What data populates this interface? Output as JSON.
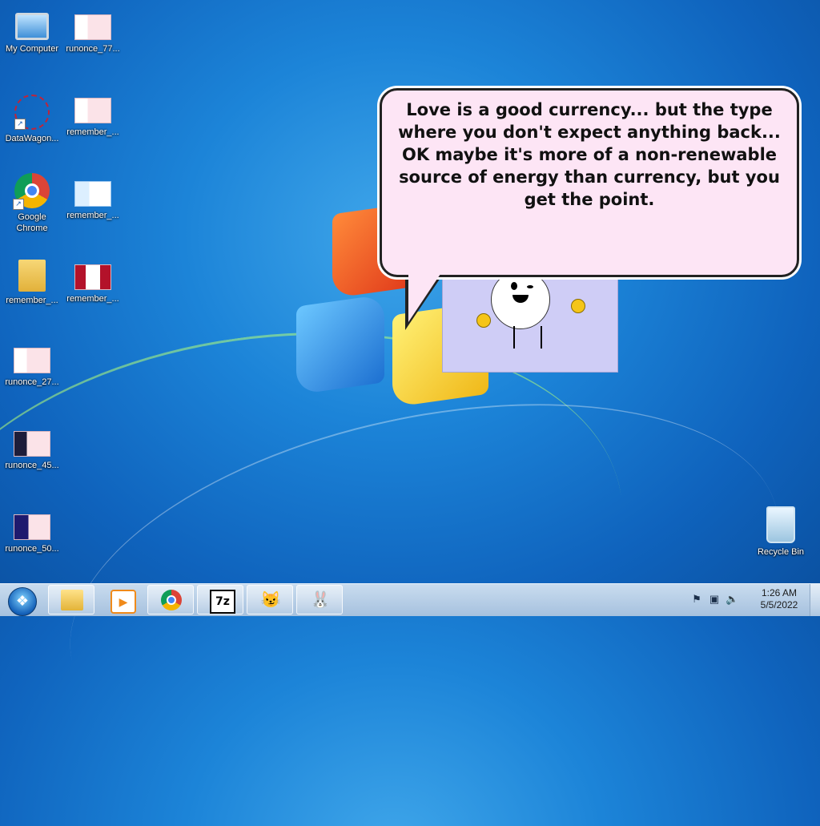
{
  "desktop": {
    "icons": [
      {
        "label": "My Computer"
      },
      {
        "label": "runonce_77..."
      },
      {
        "label": "DataWagon..."
      },
      {
        "label": "remember_..."
      },
      {
        "label": "Google Chrome"
      },
      {
        "label": "remember_..."
      },
      {
        "label": "remember_..."
      },
      {
        "label": "remember_..."
      },
      {
        "label": "runonce_27..."
      },
      {
        "label": "runonce_45..."
      },
      {
        "label": "runonce_50..."
      },
      {
        "label": "Recycle Bin"
      }
    ]
  },
  "bubble": {
    "text": "Love is a good currency... but the type where you don't expect anything back... OK maybe it's more of a non-renewable source of energy than currency, but you get the point."
  },
  "taskbar": {
    "start_icon": "windows-orb-icon",
    "pinned": [
      {
        "icon": "explorer-icon"
      },
      {
        "icon": "media-player-icon"
      },
      {
        "icon": "chrome-icon"
      },
      {
        "icon": "7zip-icon"
      },
      {
        "icon": "cat-app-icon"
      },
      {
        "icon": "bunny-app-icon"
      }
    ],
    "tray_icons": [
      "action-center-icon",
      "network-icon",
      "volume-icon"
    ],
    "clock": {
      "time": "1:26 AM",
      "date": "5/5/2022"
    }
  },
  "colors": {
    "desktop_blue": "#1c84d8",
    "bubble_bg": "#fde5f5",
    "char_box_bg": "#cfcdf6"
  }
}
